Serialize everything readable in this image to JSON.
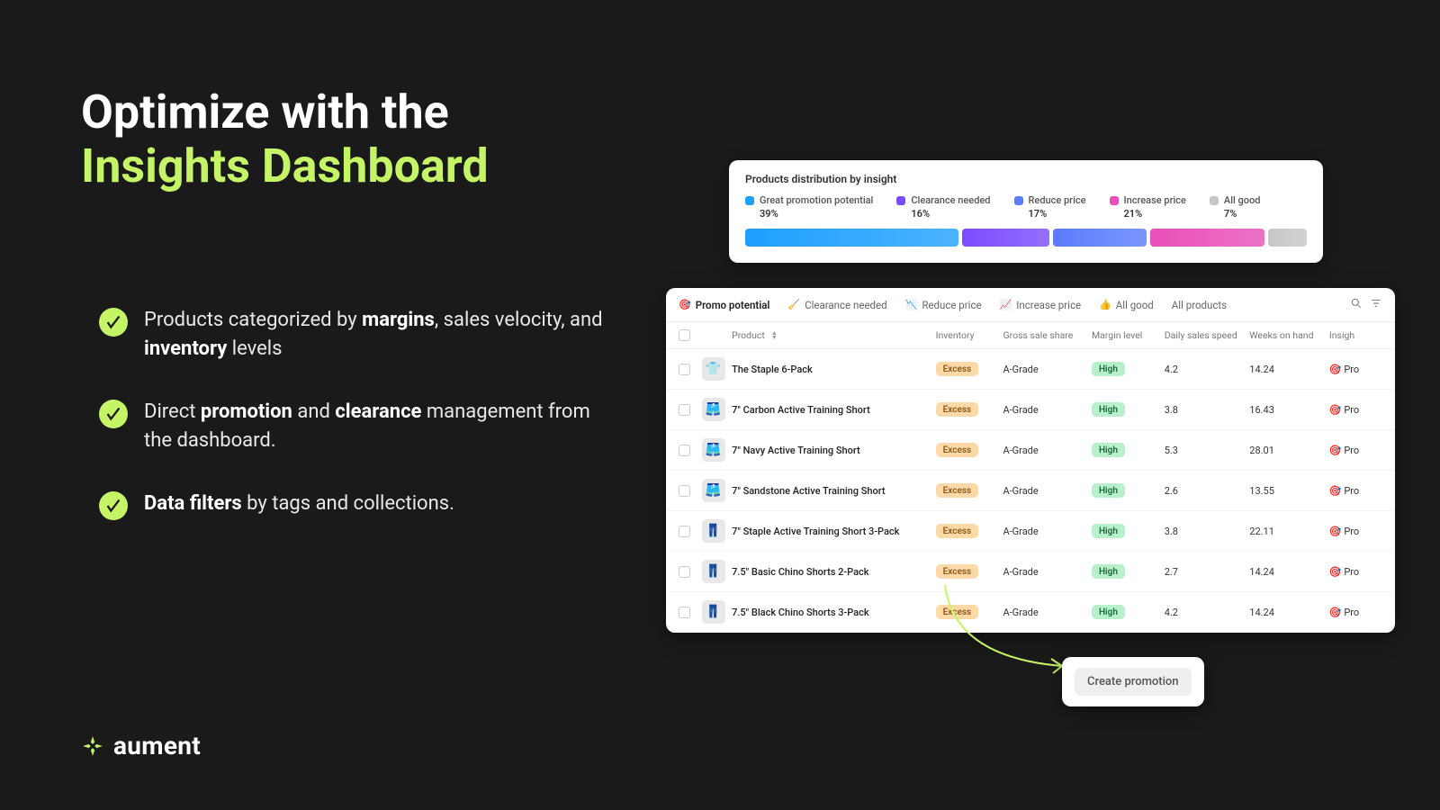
{
  "hero": {
    "line1": "Optimize with the",
    "line2": "Insights Dashboard"
  },
  "bullets": [
    {
      "pre": "Products categorized by ",
      "b1": "margins",
      "mid": ", sales velocity, and ",
      "b2": "inventory",
      "post": " levels"
    },
    {
      "pre": "Direct ",
      "b1": "promotion",
      "mid": " and ",
      "b2": "clearance",
      "post": " management from the dashboard."
    },
    {
      "pre": "",
      "b1": "Data filters",
      "mid": " by tags and collections.",
      "b2": "",
      "post": ""
    }
  ],
  "brand": {
    "name": "aument"
  },
  "dist": {
    "title": "Products distribution by insight",
    "items": [
      {
        "label": "Great promotion potential",
        "pct": "39%",
        "color": "#1ea0ff",
        "width": 39
      },
      {
        "label": "Clearance needed",
        "pct": "16%",
        "color": "#7a4cff",
        "width": 16
      },
      {
        "label": "Reduce price",
        "pct": "17%",
        "color": "#5b7cff",
        "width": 17
      },
      {
        "label": "Increase price",
        "pct": "21%",
        "color": "#e94fb8",
        "width": 21
      },
      {
        "label": "All good",
        "pct": "7%",
        "color": "#c7c7c7",
        "width": 7
      }
    ]
  },
  "table": {
    "tabs": [
      {
        "emoji": "🎯",
        "label": "Promo potential",
        "active": true
      },
      {
        "emoji": "🧹",
        "label": "Clearance needed"
      },
      {
        "emoji": "📉",
        "label": "Reduce price"
      },
      {
        "emoji": "📈",
        "label": "Increase price"
      },
      {
        "emoji": "👍",
        "label": "All good"
      },
      {
        "emoji": "",
        "label": "All products"
      }
    ],
    "headers": {
      "product": "Product",
      "inventory": "Inventory",
      "gross": "Gross sale share",
      "margin": "Margin level",
      "speed": "Daily sales speed",
      "weeks": "Weeks on hand",
      "insight": "Insigh"
    },
    "rows": [
      {
        "thumb": "👕",
        "name": "The Staple 6-Pack",
        "inv": "Excess",
        "gross": "A-Grade",
        "margin": "High",
        "speed": "4.2",
        "weeks": "14.24",
        "insight": "🎯 Pro"
      },
      {
        "thumb": "🩳",
        "name": "7\" Carbon Active Training Short",
        "inv": "Excess",
        "gross": "A-Grade",
        "margin": "High",
        "speed": "3.8",
        "weeks": "16.43",
        "insight": "🎯 Pro"
      },
      {
        "thumb": "🩳",
        "name": "7\" Navy Active Training Short",
        "inv": "Excess",
        "gross": "A-Grade",
        "margin": "High",
        "speed": "5.3",
        "weeks": "28.01",
        "insight": "🎯 Pro"
      },
      {
        "thumb": "🩳",
        "name": "7\" Sandstone Active Training Short",
        "inv": "Excess",
        "gross": "A-Grade",
        "margin": "High",
        "speed": "2.6",
        "weeks": "13.55",
        "insight": "🎯 Pro"
      },
      {
        "thumb": "👖",
        "name": "7\" Staple Active Training Short 3-Pack",
        "inv": "Excess",
        "gross": "A-Grade",
        "margin": "High",
        "speed": "3.8",
        "weeks": "22.11",
        "insight": "🎯 Pro"
      },
      {
        "thumb": "👖",
        "name": "7.5\" Basic Chino Shorts 2-Pack",
        "inv": "Excess",
        "gross": "A-Grade",
        "margin": "High",
        "speed": "2.7",
        "weeks": "14.24",
        "insight": "🎯 Pro"
      },
      {
        "thumb": "👖",
        "name": "7.5\" Black Chino Shorts 3-Pack",
        "inv": "Excess",
        "gross": "A-Grade",
        "margin": "High",
        "speed": "4.2",
        "weeks": "14.24",
        "insight": "🎯 Pro"
      }
    ]
  },
  "cta": {
    "label": "Create promotion"
  }
}
